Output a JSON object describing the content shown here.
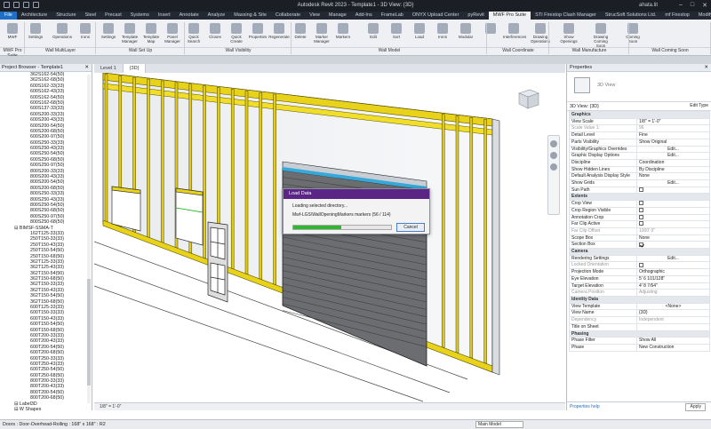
{
  "titlebar": {
    "title": "Autodesk Revit 2023 - Template1 - 3D View: {3D}",
    "user": "ahata.lit"
  },
  "tabs": [
    "File",
    "Architecture",
    "Structure",
    "Steel",
    "Precast",
    "Systems",
    "Insert",
    "Annotate",
    "Analyze",
    "Massing & Site",
    "Collaborate",
    "View",
    "Manage",
    "Add-Ins",
    "FrameLab",
    "ONYX Upload Center",
    "pyRevit",
    "MWF Pro Suite",
    "STI Firestop Clash Manager",
    "StrucSoft Solutions Ltd.",
    "mf Firestop",
    "Modify"
  ],
  "ribbon": {
    "tools": [
      "MWF",
      "Settings",
      "Operations",
      "Irons",
      "Settings",
      "Template Manager",
      "Template Map",
      "Panel Manager",
      "Quick Search",
      "Closes",
      "Quick Create",
      "Properties",
      "Regenerate",
      "Delete",
      "Marker Manager",
      "Markers",
      "Edit",
      "Sort",
      "Load",
      "Irons",
      "Modular",
      "",
      "Interferences",
      "Drawing Operations",
      "Show Openings",
      "Drawing Coming Soon",
      "Coming Soon"
    ],
    "panels": [
      "MWF Pro Suite",
      "Wall MultiLayer",
      "Wall Set Up",
      "Wall Visibility",
      "Wall Model",
      "Wall Coordinate",
      "Wall Manufacture",
      "Wall Coming Soon"
    ]
  },
  "project_browser": {
    "header": "Project Browser - Template1",
    "items": [
      "362S162-54(50)",
      "362S162-68(50)",
      "600S162-33(33)",
      "600S162-43(33)",
      "600S162-54(50)",
      "600S162-68(50)",
      "600S137-33(33)",
      "600S200-33(33)",
      "600S200-43(33)",
      "600S200-54(50)",
      "600S200-68(50)",
      "600S200-97(50)",
      "600S250-33(33)",
      "600S250-43(33)",
      "600S250-54(50)",
      "600S250-68(50)",
      "600S250-97(50)",
      "800S200-33(33)",
      "800S200-43(33)",
      "800S200-54(50)",
      "800S200-68(50)",
      "800S250-33(33)",
      "800S250-43(33)",
      "800S250-54(50)",
      "800S250-68(50)",
      "800S250-97(50)",
      "800S250-68(50)",
      "BIMSF-SSMA-T",
      "162T125-33(33)",
      "250T150-33(33)",
      "250T150-43(33)",
      "250T150-54(50)",
      "250T150-68(50)",
      "362T125-33(33)",
      "362T125-43(33)",
      "362T150-54(50)",
      "362T150-68(50)",
      "362T150-33(33)",
      "362T150-43(33)",
      "362T150-54(50)",
      "362T150-68(50)",
      "600T125-33(33)",
      "600T150-33(33)",
      "600T150-43(33)",
      "600T150-54(50)",
      "600T150-68(50)",
      "600T200-33(33)",
      "600T200-43(33)",
      "600T200-54(50)",
      "600T200-68(50)",
      "600T250-33(33)",
      "600T250-43(33)",
      "600T250-54(50)",
      "600T250-68(50)",
      "800T200-33(33)",
      "800T200-43(33)",
      "800T200-54(50)",
      "800T200-68(50)",
      "Label3D",
      "W Shapes"
    ]
  },
  "view": {
    "tabs": [
      "Level 1",
      "{3D}"
    ],
    "control_bar": "1/8\" = 1'-0\""
  },
  "dialog": {
    "title": "Load Data",
    "message": "Loading selected directory...",
    "status": "Mwf-LGS\\WallOpeningMarkers markers (56 / 114)",
    "progress": 0.49,
    "cancel": "Cancel"
  },
  "properties": {
    "header": "Properties",
    "type_name": "3D View",
    "selector": "3D View: {3D}",
    "edit_type": "Edit Type",
    "rows": [
      {
        "cat": "Graphics"
      },
      {
        "k": "View Scale",
        "v": "1/8\" = 1'-0\""
      },
      {
        "k": "Scale Value    1:",
        "v": "96",
        "gray": true
      },
      {
        "k": "Detail Level",
        "v": "Fine"
      },
      {
        "k": "Parts Visibility",
        "v": "Show Original"
      },
      {
        "k": "Visibility/Graphics Overrides",
        "v": "Edit...",
        "btn": true
      },
      {
        "k": "Graphic Display Options",
        "v": "Edit...",
        "btn": true
      },
      {
        "k": "Discipline",
        "v": "Coordination"
      },
      {
        "k": "Show Hidden Lines",
        "v": "By Discipline"
      },
      {
        "k": "Default Analysis Display Style",
        "v": "None"
      },
      {
        "k": "Show Grids",
        "v": "Edit...",
        "btn": true
      },
      {
        "k": "Sun Path",
        "chk": false
      },
      {
        "cat": "Extents"
      },
      {
        "k": "Crop View",
        "chk": false
      },
      {
        "k": "Crop Region Visible",
        "chk": false
      },
      {
        "k": "Annotation Crop",
        "chk": false
      },
      {
        "k": "Far Clip Active",
        "chk": false
      },
      {
        "k": "Far Clip Offset",
        "v": "1000' 0\"",
        "gray": true
      },
      {
        "k": "Scope Box",
        "v": "None"
      },
      {
        "k": "Section Box",
        "chk": true
      },
      {
        "cat": "Camera"
      },
      {
        "k": "Rendering Settings",
        "v": "Edit...",
        "btn": true
      },
      {
        "k": "Locked Orientation",
        "chk": false,
        "gray": true
      },
      {
        "k": "Projection Mode",
        "v": "Orthographic"
      },
      {
        "k": "Eye Elevation",
        "v": "5' 6 101/128\""
      },
      {
        "k": "Target Elevation",
        "v": "4' 8 7/64\""
      },
      {
        "k": "Camera Position",
        "v": "Adjusting",
        "gray": true
      },
      {
        "cat": "Identity Data"
      },
      {
        "k": "View Template",
        "v": "<None>",
        "btn": true
      },
      {
        "k": "View Name",
        "v": "{3D}"
      },
      {
        "k": "Dependency",
        "v": "Independent",
        "gray": true
      },
      {
        "k": "Title on Sheet",
        "v": ""
      },
      {
        "cat": "Phasing"
      },
      {
        "k": "Phase Filter",
        "v": "Show All"
      },
      {
        "k": "Phase",
        "v": "New Construction"
      }
    ],
    "help": "Properties help",
    "apply": "Apply"
  },
  "status": {
    "text": "Doors : Door-Overhead-Rolling : 168\" x 168\" : R2",
    "model": "Main Model"
  }
}
